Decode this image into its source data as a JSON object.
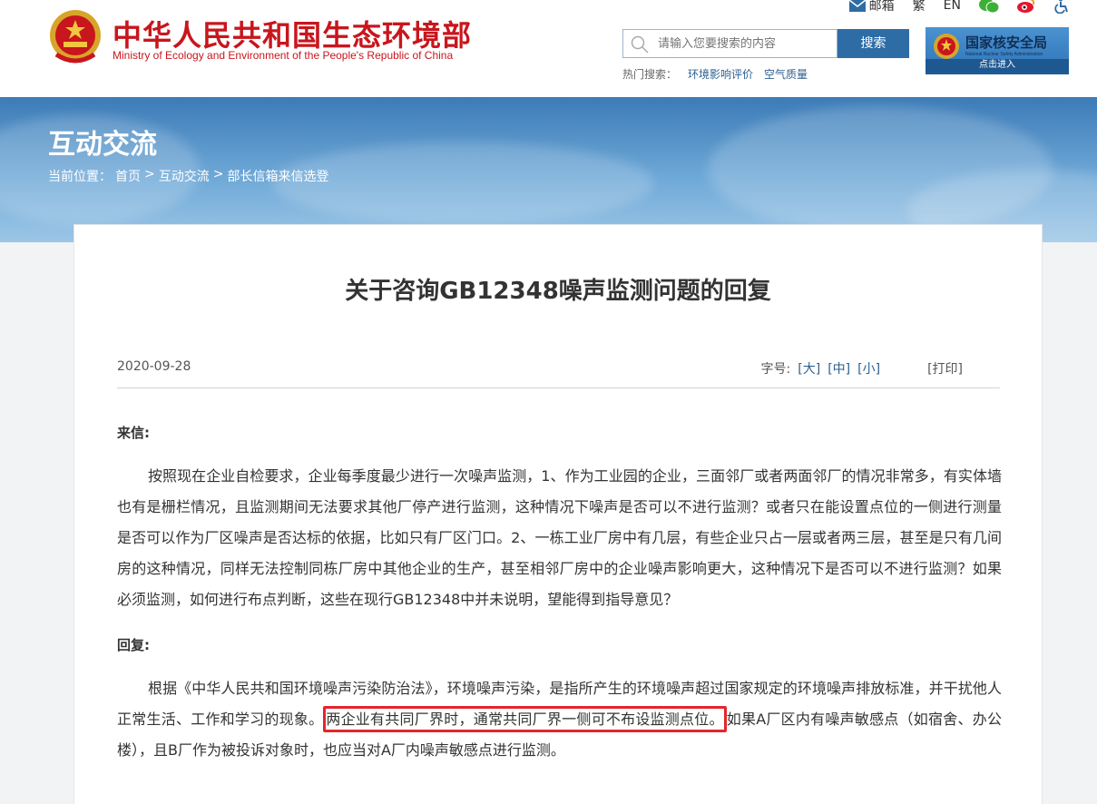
{
  "header": {
    "title": "中华人民共和国生态环境部",
    "subtitle": "Ministry of Ecology and Environment of the People's Republic of China",
    "top_links": [
      "邮箱",
      "繁",
      "EN"
    ],
    "search": {
      "placeholder": "请输入您要搜索的内容",
      "button": "搜索"
    },
    "hot_label": "热门搜索：",
    "hot_items": [
      "环境影响评价",
      "空气质量"
    ],
    "nnsa": {
      "title": "国家核安全局",
      "en": "National Nuclear Safety Administration",
      "cta": "点击进入"
    }
  },
  "banner": {
    "title": "互动交流",
    "breadcrumb": [
      "当前位置：",
      "首页",
      ">",
      "互动交流",
      ">",
      "部长信箱来信选登"
    ]
  },
  "article": {
    "title": "关于咨询GB12348噪声监测问题的回复",
    "date": "2020-09-28",
    "font_label": "字号:",
    "font_sizes": [
      "[大]",
      "[中]",
      "[小]"
    ],
    "print": "[打印]",
    "letter_heading": "来信:",
    "letter_body": "按照现在企业自检要求，企业每季度最少进行一次噪声监测，1、作为工业园的企业，三面邻厂或者两面邻厂的情况非常多，有实体墙也有是栅栏情况，且监测期间无法要求其他厂停产进行监测，这种情况下噪声是否可以不进行监测？或者只在能设置点位的一侧进行测量是否可以作为厂区噪声是否达标的依据，比如只有厂区门口。2、一栋工业厂房中有几层，有些企业只占一层或者两三层，甚至是只有几间房的这种情况，同样无法控制同栋厂房中其他企业的生产，甚至相邻厂房中的企业噪声影响更大，这种情况下是否可以不进行监测？如果必须监测，如何进行布点判断，这些在现行GB12348中并未说明，望能得到指导意见？",
    "reply_heading": "回复:",
    "reply_part1": "根据《中华人民共和国环境噪声污染防治法》，环境噪声污染，是指所产生的环境噪声超过国家规定的环境噪声排放标准，并干扰他人正常生活、工作和学习的现象。",
    "reply_highlight": "两企业有共同厂界时，通常共同厂界一侧可不布设监测点位。",
    "reply_part2": "如果A厂区内有噪声敏感点（如宿舍、办公楼），且B厂作为被投诉对象时，也应当对A厂内噪声敏感点进行监测。"
  },
  "colors": {
    "brand_red": "#c8161d",
    "link_blue": "#2e5f8f",
    "highlight_red": "#e3262b",
    "button_blue": "#2e6ca6"
  }
}
